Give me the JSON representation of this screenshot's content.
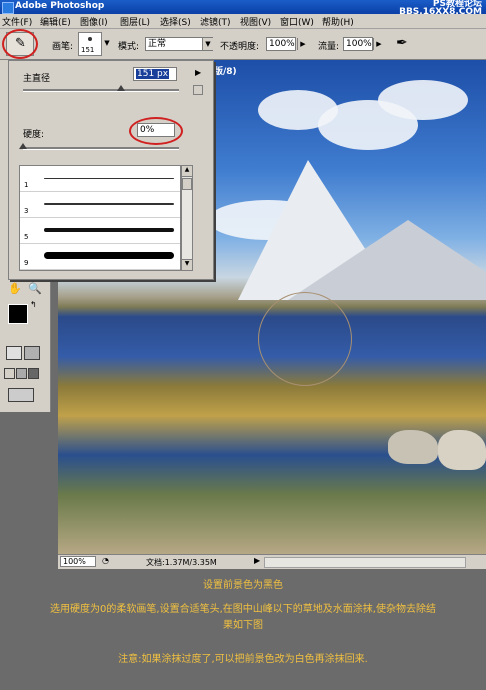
{
  "window": {
    "title": "Adobe Photoshop",
    "watermark_line1": "PS教程论坛",
    "watermark_line2": "BBS.16XX8.COM"
  },
  "menu": [
    "文件(F)",
    "编辑(E)",
    "图像(I)",
    "图层(L)",
    "选择(S)",
    "滤镜(T)",
    "视图(V)",
    "窗口(W)",
    "帮助(H)"
  ],
  "options": {
    "brush_label": "画笔:",
    "brush_size": "151",
    "mode_label": "模式:",
    "mode_value": "正常",
    "opacity_label": "不透明度:",
    "opacity_value": "100%",
    "flow_label": "流量:",
    "flow_value": "100%"
  },
  "brush_panel": {
    "diameter_label": "主直径",
    "diameter_value": "151 px",
    "hardness_label": "硬度:",
    "hardness_value": "0%",
    "presets": [
      {
        "num": "1"
      },
      {
        "num": "3"
      },
      {
        "num": "5"
      },
      {
        "num": "9"
      }
    ]
  },
  "document": {
    "title": "蒙版/8)"
  },
  "status": {
    "zoom": "100%",
    "doc_info": "文档:1.37M/3.35M"
  },
  "captions": [
    "设置前景色为黑色",
    "选用硬度为0的柔软画笔,设置合适笔头,在图中山峰以下的草地及水面涂抹,使杂物去除结",
    "果如下图",
    "注意:如果涂抹过度了,可以把前景色改为白色再涂抹回来."
  ],
  "colors": {
    "highlight_circle": "#d02020",
    "caption": "#f0c040"
  }
}
